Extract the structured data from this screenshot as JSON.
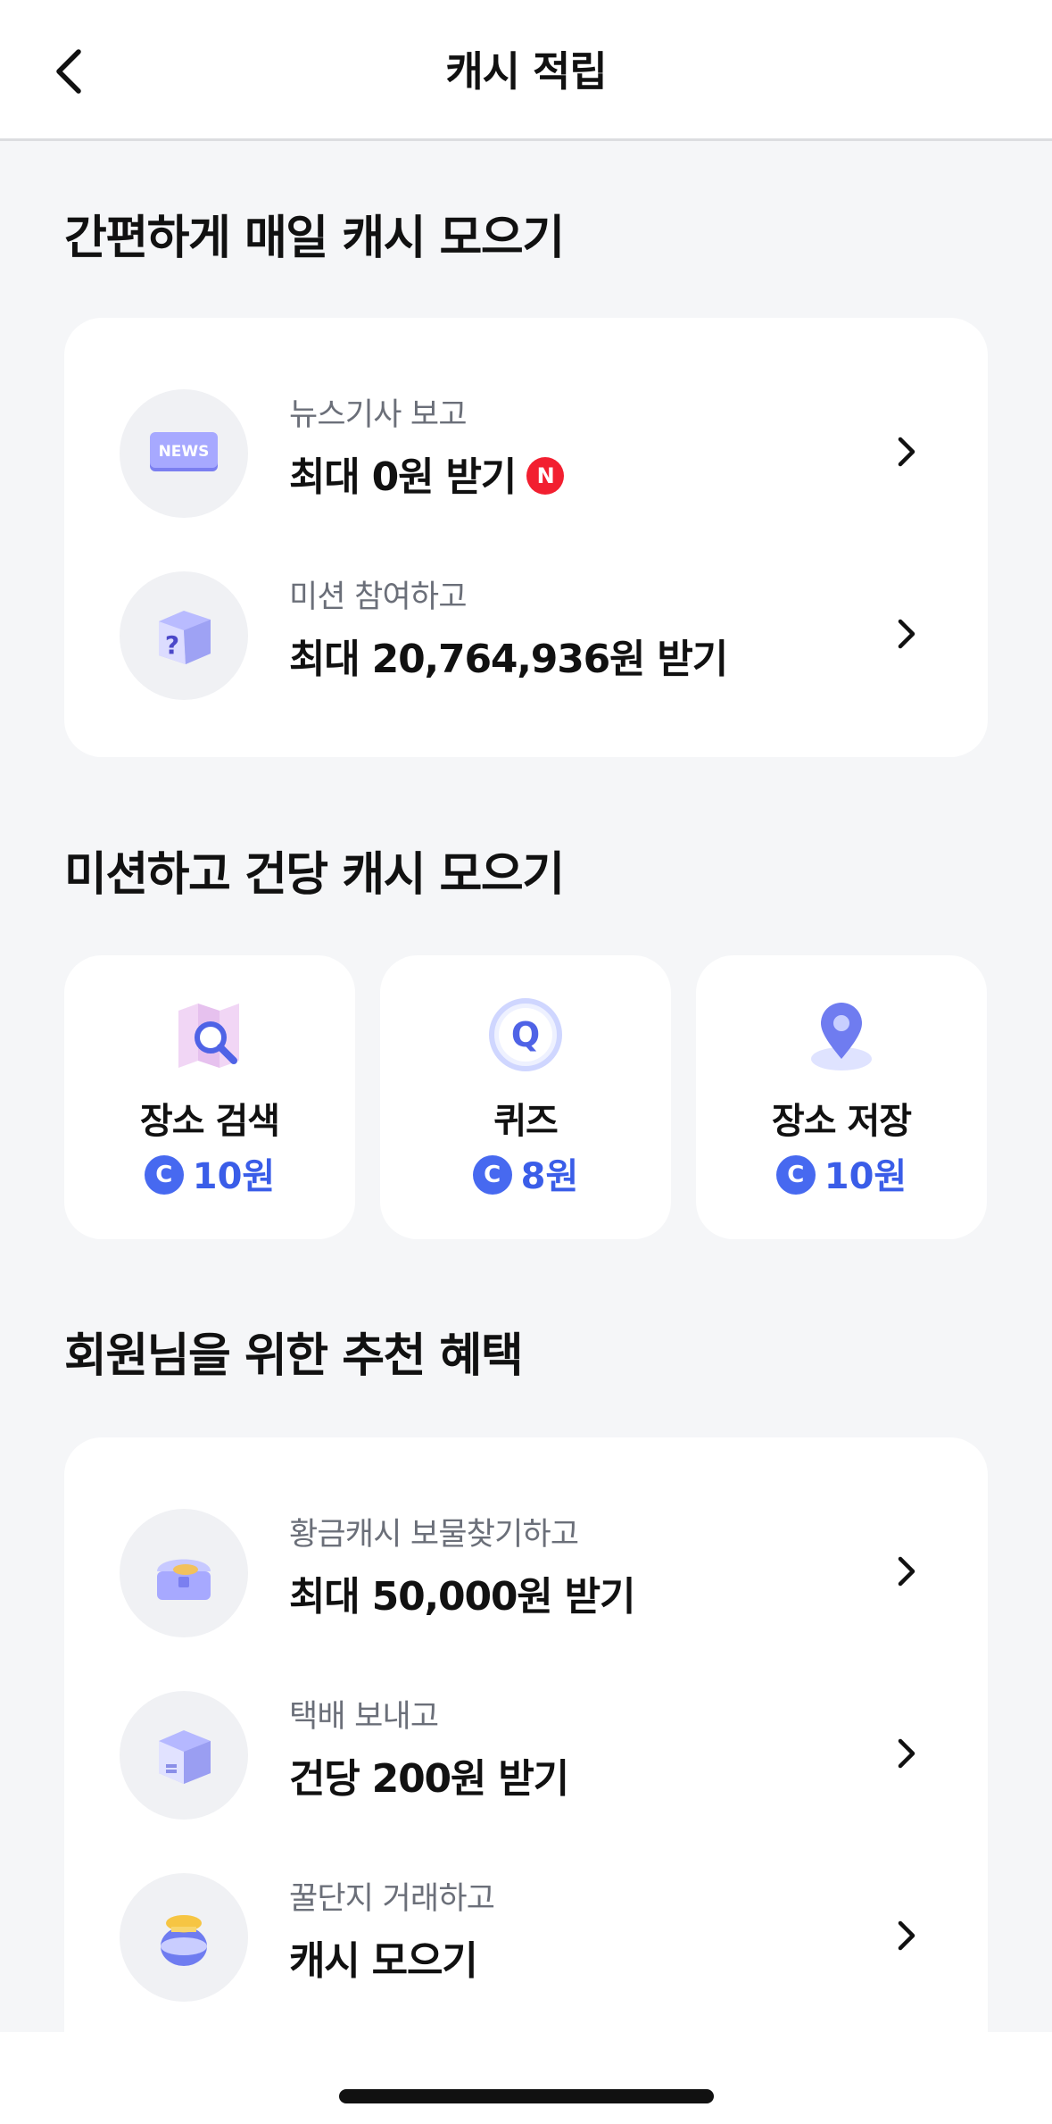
{
  "header": {
    "title": "캐시 적립",
    "back_icon": "chevron-left-icon"
  },
  "daily": {
    "title": "간편하게 매일 캐시 모으기",
    "items": [
      {
        "sub": "뉴스기사 보고",
        "main": "최대 0원 받기",
        "badge": "N",
        "icon": "news-icon"
      },
      {
        "sub": "미션 참여하고",
        "main": "최대 20,764,936원 받기",
        "icon": "mystery-box-icon"
      }
    ]
  },
  "missions": {
    "title": "미션하고 건당 캐시 모으기",
    "coin_symbol": "C",
    "tiles": [
      {
        "label": "장소 검색",
        "reward": "10원",
        "icon": "map-search-icon"
      },
      {
        "label": "퀴즈",
        "reward": "8원",
        "icon": "quiz-icon"
      },
      {
        "label": "장소 저장",
        "reward": "10원",
        "icon": "location-pin-icon"
      }
    ]
  },
  "benefits": {
    "title": "회원님을 위한 추천 혜택",
    "items": [
      {
        "sub": "황금캐시 보물찾기하고",
        "main": "최대 50,000원 받기",
        "icon": "treasure-chest-icon"
      },
      {
        "sub": "택배 보내고",
        "main": "건당 200원 받기",
        "icon": "parcel-box-icon"
      },
      {
        "sub": "꿀단지 거래하고",
        "main": "캐시 모으기",
        "icon": "honey-jar-icon"
      }
    ]
  },
  "colors": {
    "accent": "#4769f0",
    "badge_red": "#f21f30",
    "background": "#f5f6f8"
  }
}
